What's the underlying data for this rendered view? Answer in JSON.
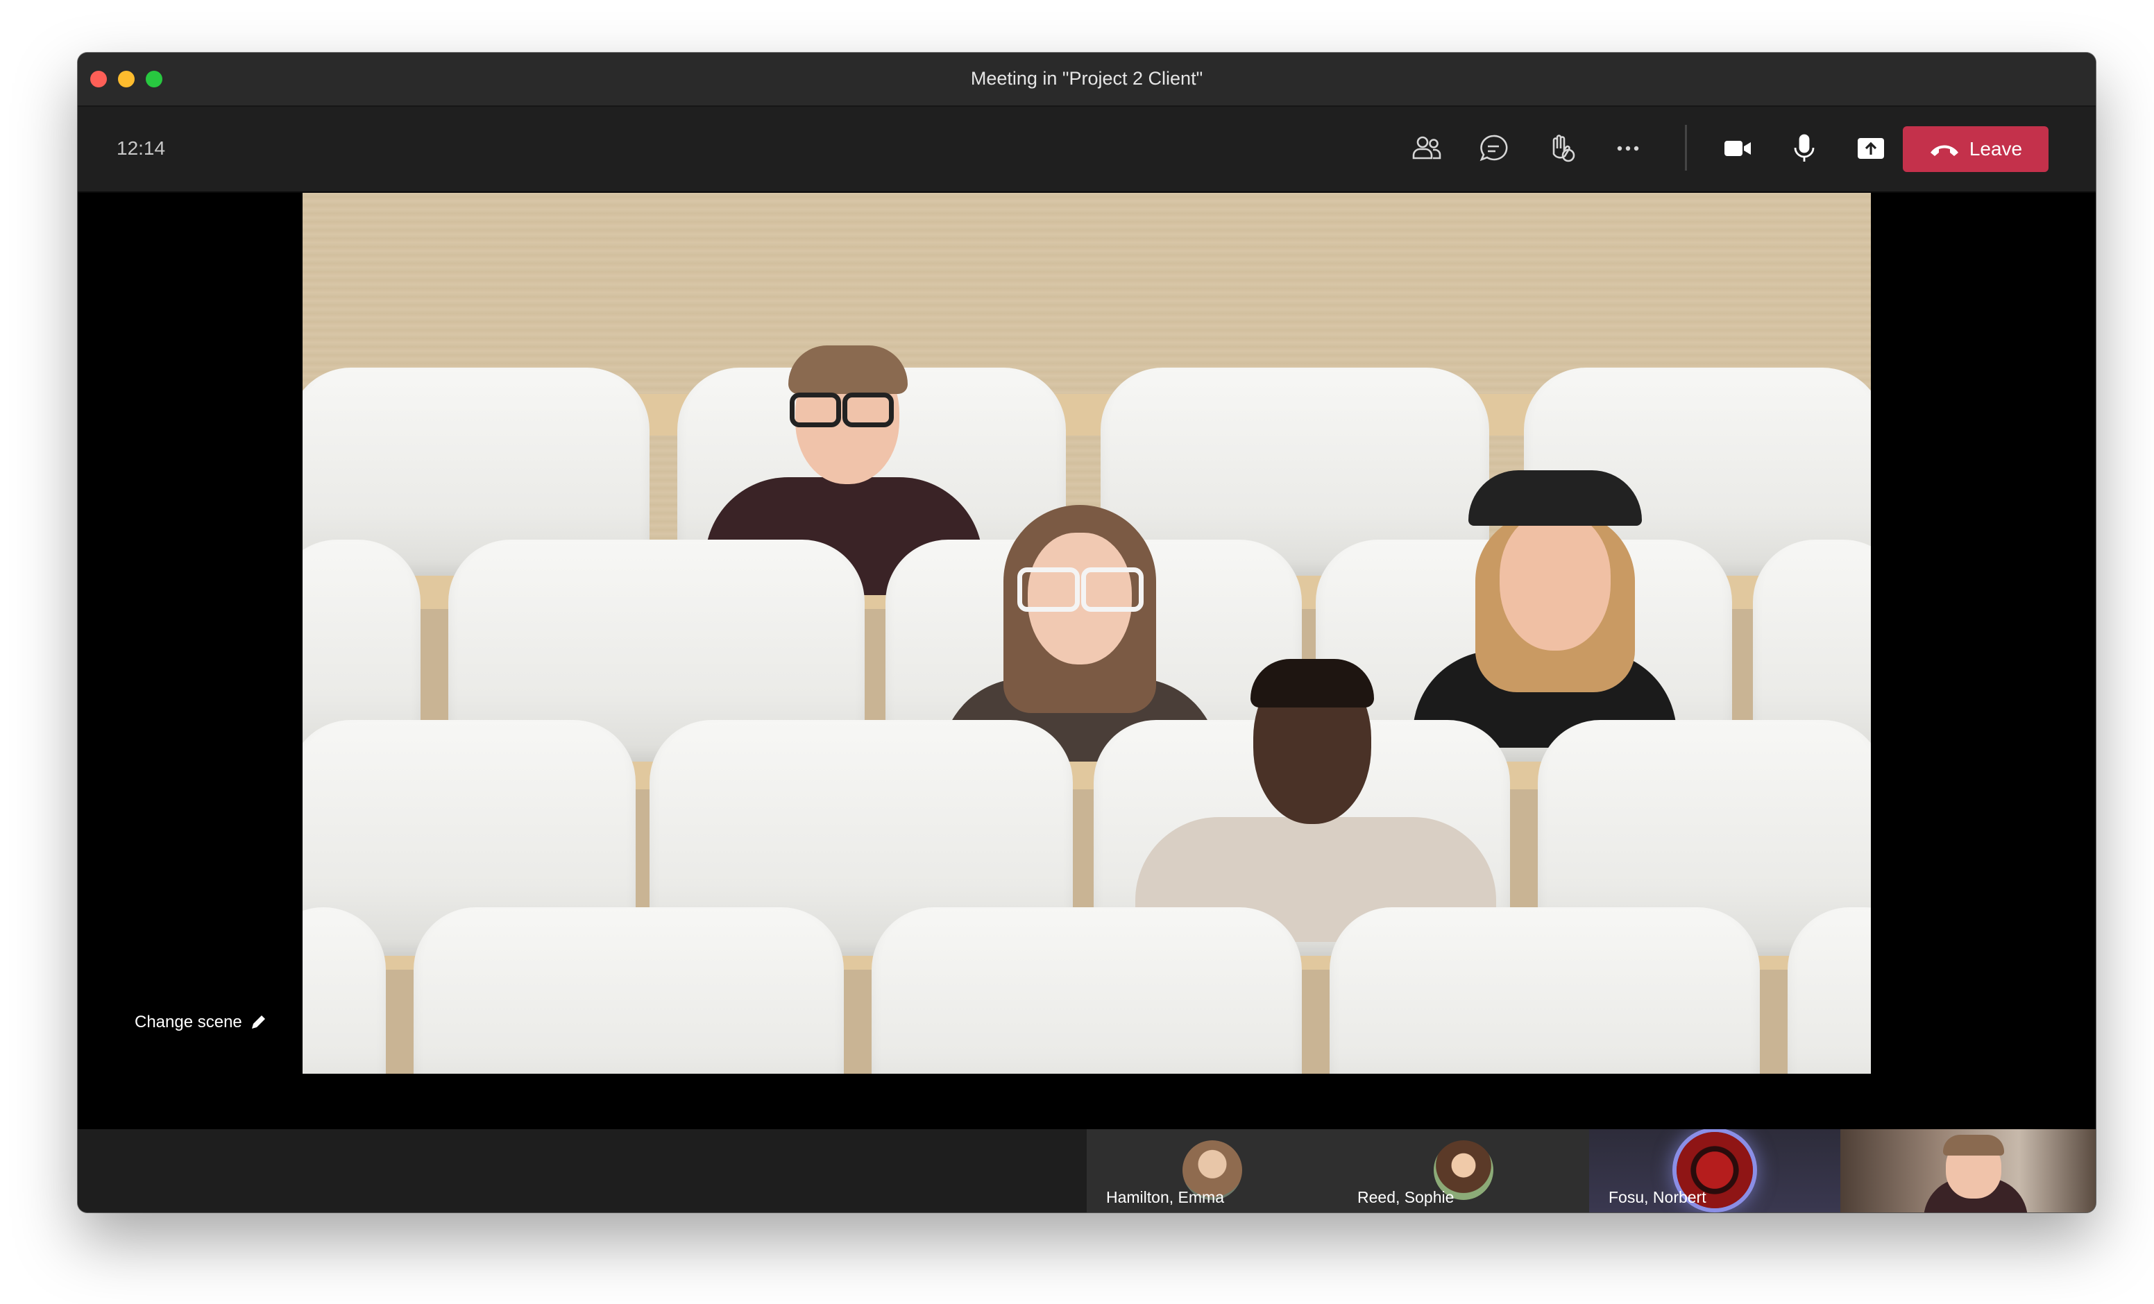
{
  "window": {
    "title": "Meeting in \"Project 2 Client\""
  },
  "toolbar": {
    "time": "12:14",
    "icons": [
      "people-icon",
      "chat-icon",
      "raise-hand-icon",
      "more-icon",
      "camera-icon",
      "microphone-icon",
      "share-screen-icon"
    ],
    "leave_label": "Leave",
    "leave_color": "#c4314b"
  },
  "stage": {
    "scene_name": "Together mode",
    "change_scene_label": "Change scene"
  },
  "participants": [
    {
      "name": "Hamilton, Emma",
      "speaking": false
    },
    {
      "name": "Reed, Sophie",
      "speaking": false
    },
    {
      "name": "Fosu, Norbert",
      "speaking": true
    }
  ],
  "colors": {
    "accent_speaking": "#8b8fe6",
    "leave": "#c4314b"
  }
}
